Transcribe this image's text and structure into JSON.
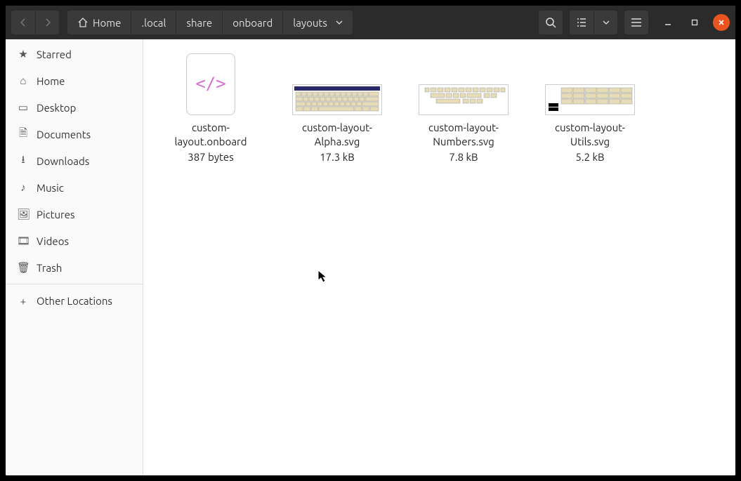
{
  "breadcrumb": [
    "Home",
    ".local",
    "share",
    "onboard",
    "layouts"
  ],
  "sidebar": {
    "items": [
      {
        "icon": "star",
        "label": "Starred"
      },
      {
        "icon": "home",
        "label": "Home"
      },
      {
        "icon": "desktop",
        "label": "Desktop"
      },
      {
        "icon": "documents",
        "label": "Documents"
      },
      {
        "icon": "downloads",
        "label": "Downloads"
      },
      {
        "icon": "music",
        "label": "Music"
      },
      {
        "icon": "pictures",
        "label": "Pictures"
      },
      {
        "icon": "videos",
        "label": "Videos"
      },
      {
        "icon": "trash",
        "label": "Trash"
      }
    ],
    "other": {
      "label": "Other Locations"
    }
  },
  "files": [
    {
      "name": "custom-layout.onboard",
      "size": "387 bytes",
      "type": "xml"
    },
    {
      "name": "custom-layout-Alpha.svg",
      "size": "17.3 kB",
      "type": "kbd-full"
    },
    {
      "name": "custom-layout-Numbers.svg",
      "size": "7.8 kB",
      "type": "kbd-num"
    },
    {
      "name": "custom-layout-Utils.svg",
      "size": "5.2 kB",
      "type": "kbd-util"
    }
  ]
}
